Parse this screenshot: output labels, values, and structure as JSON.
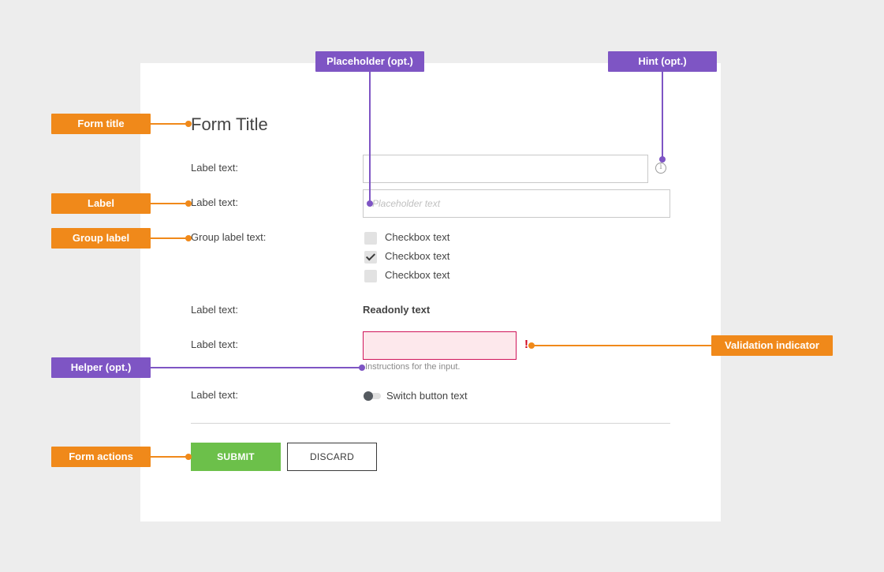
{
  "form": {
    "title": "Form Title",
    "rows": [
      {
        "label": "Label text:"
      },
      {
        "label": "Label text:",
        "placeholder": "Placeholder text"
      },
      {
        "label": "Group label text:"
      },
      {
        "label": "Label text:",
        "readonly_value": "Readonly text"
      },
      {
        "label": "Label text:",
        "error_indicator": "!",
        "helper": "Instructions for the input."
      },
      {
        "label": "Label text:",
        "switch_text": "Switch button text"
      }
    ],
    "checkboxes": [
      {
        "text": "Checkbox text",
        "checked": false
      },
      {
        "text": "Checkbox text",
        "checked": true
      },
      {
        "text": "Checkbox text",
        "checked": false
      }
    ],
    "actions": {
      "submit": "SUBMIT",
      "discard": "DISCARD"
    }
  },
  "annotations": {
    "form_title": "Form title",
    "label": "Label",
    "group_label": "Group label",
    "helper": "Helper (opt.)",
    "form_actions": "Form actions",
    "placeholder": "Placeholder (opt.)",
    "hint": "Hint (opt.)",
    "validation": "Validation indicator"
  },
  "colors": {
    "background": "#ededed",
    "card": "#ffffff",
    "annotation_orange": "#f0891a",
    "annotation_purple": "#7e55c4",
    "submit_green": "#6cc04a",
    "error_border": "#d0145a",
    "error_fill": "#fde8ec"
  }
}
